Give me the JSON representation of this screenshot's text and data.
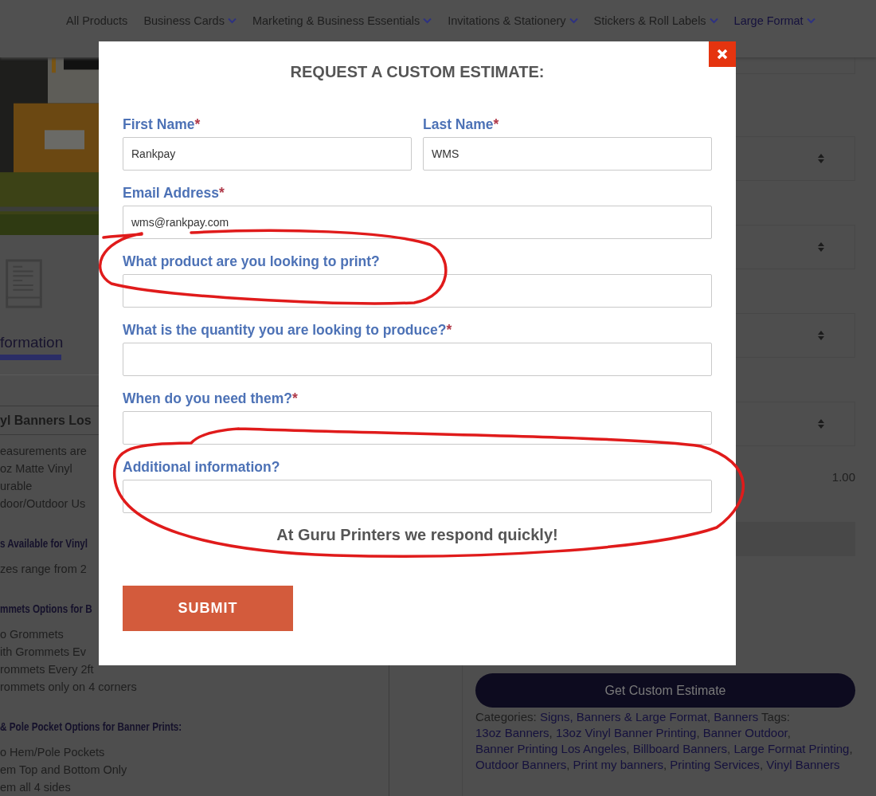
{
  "nav": {
    "items": [
      {
        "label": "All Products",
        "dropdown": false,
        "selected": false
      },
      {
        "label": "Business Cards",
        "dropdown": true,
        "selected": false
      },
      {
        "label": "Marketing & Business Essentials",
        "dropdown": true,
        "selected": false
      },
      {
        "label": "Invitations & Stationery",
        "dropdown": true,
        "selected": false
      },
      {
        "label": "Stickers & Roll Labels",
        "dropdown": true,
        "selected": false
      },
      {
        "label": "Large Format",
        "dropdown": true,
        "selected": true
      }
    ]
  },
  "product": {
    "tab_label": "formation",
    "lines": [
      {
        "kind": "title",
        "text": "yl Banners Los"
      },
      {
        "kind": "item",
        "text": "easurements are"
      },
      {
        "kind": "item",
        "text": "oz Matte Vinyl"
      },
      {
        "kind": "item",
        "text": "urable"
      },
      {
        "kind": "item",
        "text": "door/Outdoor Us"
      },
      {
        "kind": "heading",
        "text": "s Available for Vinyl"
      },
      {
        "kind": "item",
        "text": "zes range from 2"
      },
      {
        "kind": "heading",
        "text": "mmets Options for B"
      },
      {
        "kind": "item",
        "text": "o Grommets"
      },
      {
        "kind": "item",
        "text": "ith Grommets Ev"
      },
      {
        "kind": "item",
        "text": "rommets Every 2ft"
      },
      {
        "kind": "item",
        "text": "rommets only on 4 corners"
      },
      {
        "kind": "heading",
        "text": "& Pole Pocket Options for Banner Prints:"
      },
      {
        "kind": "item",
        "text": "o Hem/Pole Pockets"
      },
      {
        "kind": "item",
        "text": "em Top and Bottom Only"
      },
      {
        "kind": "item",
        "text": "em all 4 sides"
      }
    ]
  },
  "options": {
    "dropdowns": [
      {
        "kind": "dropdown"
      },
      {
        "kind": "dropdown"
      },
      {
        "kind": "dropdown"
      },
      {
        "kind": "dropdown"
      }
    ],
    "quantity_value": "1.00",
    "estimate_button": "Get Custom Estimate",
    "meta": [
      {
        "text": "Categories: ",
        "link": false
      },
      {
        "text": "Signs, Banners & Large Format",
        "link": true
      },
      {
        "text": ", ",
        "link": false
      },
      {
        "text": "Banners",
        "link": true
      },
      {
        "text": " Tags: ",
        "link": false
      },
      {
        "text": "13oz Banners",
        "link": true
      },
      {
        "text": ", ",
        "link": false
      },
      {
        "text": "13oz Vinyl Banner Printing",
        "link": true
      },
      {
        "text": ", ",
        "link": false
      },
      {
        "text": "Banner Outdoor",
        "link": true
      },
      {
        "text": ", ",
        "link": false
      },
      {
        "text": "Banner Printing Los Angeles",
        "link": true
      },
      {
        "text": ", ",
        "link": false
      },
      {
        "text": "Billboard Banners",
        "link": true
      },
      {
        "text": ", ",
        "link": false
      },
      {
        "text": "Large Format Printing",
        "link": true
      },
      {
        "text": ", ",
        "link": false
      },
      {
        "text": "Outdoor Banners",
        "link": true
      },
      {
        "text": ", ",
        "link": false
      },
      {
        "text": "Print my banners",
        "link": true
      },
      {
        "text": ", ",
        "link": false
      },
      {
        "text": "Printing Services",
        "link": true
      },
      {
        "text": ", ",
        "link": false
      },
      {
        "text": "Vinyl Banners",
        "link": true
      }
    ]
  },
  "modal": {
    "title": "REQUEST A CUSTOM ESTIMATE:",
    "rows": [
      [
        {
          "label": "First Name",
          "required_mark": "*",
          "value": "Rankpay"
        },
        {
          "label": "Last Name",
          "required_mark": "*",
          "value": "WMS"
        }
      ],
      [
        {
          "label": "Email Address",
          "required_mark": "*",
          "value": "wms@rankpay.com"
        }
      ],
      [
        {
          "label": "What product are you looking to print?"
        }
      ],
      [
        {
          "label": "What is the quantity you are looking to produce?",
          "required_mark": "*"
        }
      ],
      [
        {
          "label": "When do you need them?",
          "required_mark": "*"
        }
      ],
      [
        {
          "label": "Additional information?"
        }
      ]
    ],
    "note": "At Guru Printers we respond quickly!",
    "submit": "SUBMIT"
  }
}
